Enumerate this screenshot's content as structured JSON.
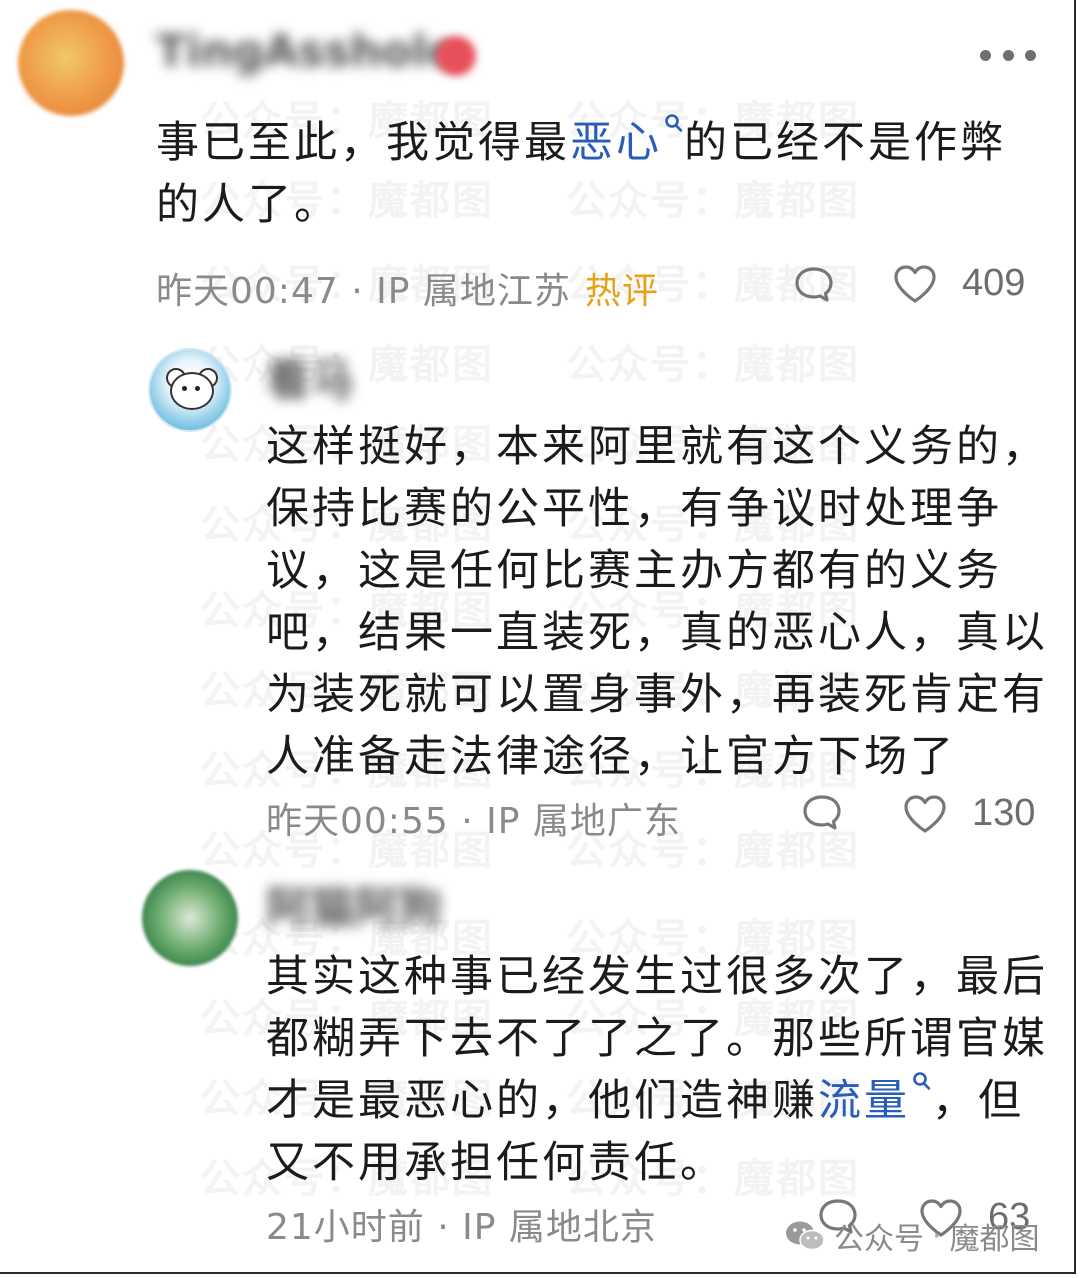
{
  "watermark": "公众号：魔都图",
  "comments": [
    {
      "username": "TingAsshole",
      "text_before": "事已至此，我觉得最",
      "keyword": "恶心",
      "text_after": "的已经不是作弊的人了。",
      "time": "昨天00:47",
      "location": "IP 属地江苏",
      "tag": "热评",
      "likes": "409"
    },
    {
      "username": "看马",
      "text": "这样挺好，本来阿里就有这个义务的，保持比赛的公平性，有争议时处理争议，这是任何比赛主办方都有的义务吧，结果一直装死，真的恶心人，真以为装死就可以置身事外，再装死肯定有人准备走法律途径，让官方下场了",
      "time": "昨天00:55",
      "location": "IP 属地广东",
      "likes": "130"
    },
    {
      "username": "阿猫阿狗",
      "text_before": "其实这种事已经发生过很多次了，最后都糊弄下去不了了之了。那些所谓官媒才是最恶心的，他们造神赚",
      "keyword": "流量",
      "text_after": "，但又不用承担任何责任。",
      "time": "21小时前",
      "location": "IP 属地北京",
      "likes": "63"
    }
  ],
  "brand": {
    "prefix": "公众号",
    "separator": "·",
    "name": "魔都图"
  },
  "icons": {
    "more": "more-dots-icon",
    "reply": "comment-bubble-icon",
    "like": "heart-icon",
    "keyword_search": "search-icon",
    "brand": "wechat-icon"
  },
  "colors": {
    "keyword": "#2a5db8",
    "hot_tag": "#e8a219",
    "meta": "#8a8a8a"
  }
}
